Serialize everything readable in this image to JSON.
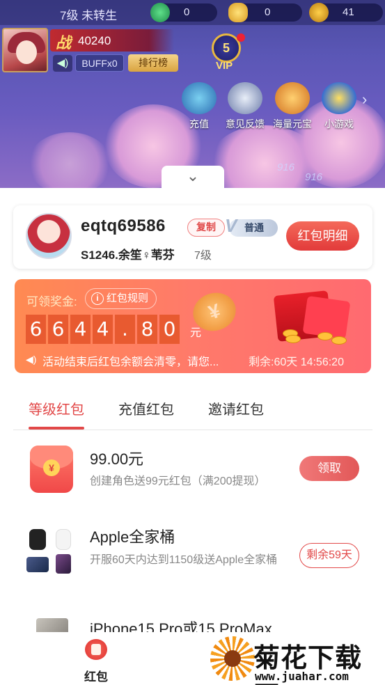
{
  "game_hud": {
    "level_status": "7级 未转生",
    "resources": [
      {
        "icon": "jade-icon",
        "value": "0"
      },
      {
        "icon": "gold-ingot-icon",
        "value": "0"
      },
      {
        "icon": "coin-icon",
        "value": "41"
      }
    ],
    "power_char": "战",
    "power_value": "40240",
    "buff_label": "BUFFx0",
    "rank_label": "排行榜",
    "vip_level": "5",
    "vip_label": "VIP",
    "shortcuts": [
      {
        "label": "充值",
        "icon": "recharge-icon"
      },
      {
        "label": "意见反馈",
        "icon": "feedback-icon"
      },
      {
        "label": "海量元宝",
        "icon": "treasure-icon"
      },
      {
        "label": "小游戏",
        "icon": "minigame-icon"
      }
    ],
    "scene_text": [
      "916",
      "916"
    ]
  },
  "user": {
    "username": "eqtq69586",
    "copy_label": "复制",
    "tier_label": "普通",
    "server_name": "S1246.余笙♀苇芬",
    "level": "7级",
    "detail_button": "红包明细"
  },
  "prize": {
    "label": "可领奖金:",
    "rule_button": "红包规则",
    "amount_digits": [
      "6",
      "6",
      "4",
      "4",
      ".",
      "8",
      "0"
    ],
    "unit": "元",
    "notice": "活动结束后红包余额会清零，请您...",
    "remaining": "剩余:60天 14:56:20"
  },
  "tabs": [
    {
      "label": "等级红包",
      "active": true
    },
    {
      "label": "充值红包",
      "active": false
    },
    {
      "label": "邀请红包",
      "active": false
    }
  ],
  "items": [
    {
      "title": "99.00元",
      "desc": "创建角色送99元红包（满200提现）",
      "action": "领取"
    },
    {
      "title": "Apple全家桶",
      "desc": "开服60天内达到1150级送Apple全家桶",
      "action": "剩余59天"
    },
    {
      "title": "iPhone15 Pro或15 ProMax"
    }
  ],
  "bottom_nav": {
    "label": "红包"
  },
  "watermark": {
    "brand": "菊花下载网",
    "url": "www.juahar.com"
  },
  "colors": {
    "accent": "#e24848",
    "prize_bg": "#ff7a6a"
  }
}
